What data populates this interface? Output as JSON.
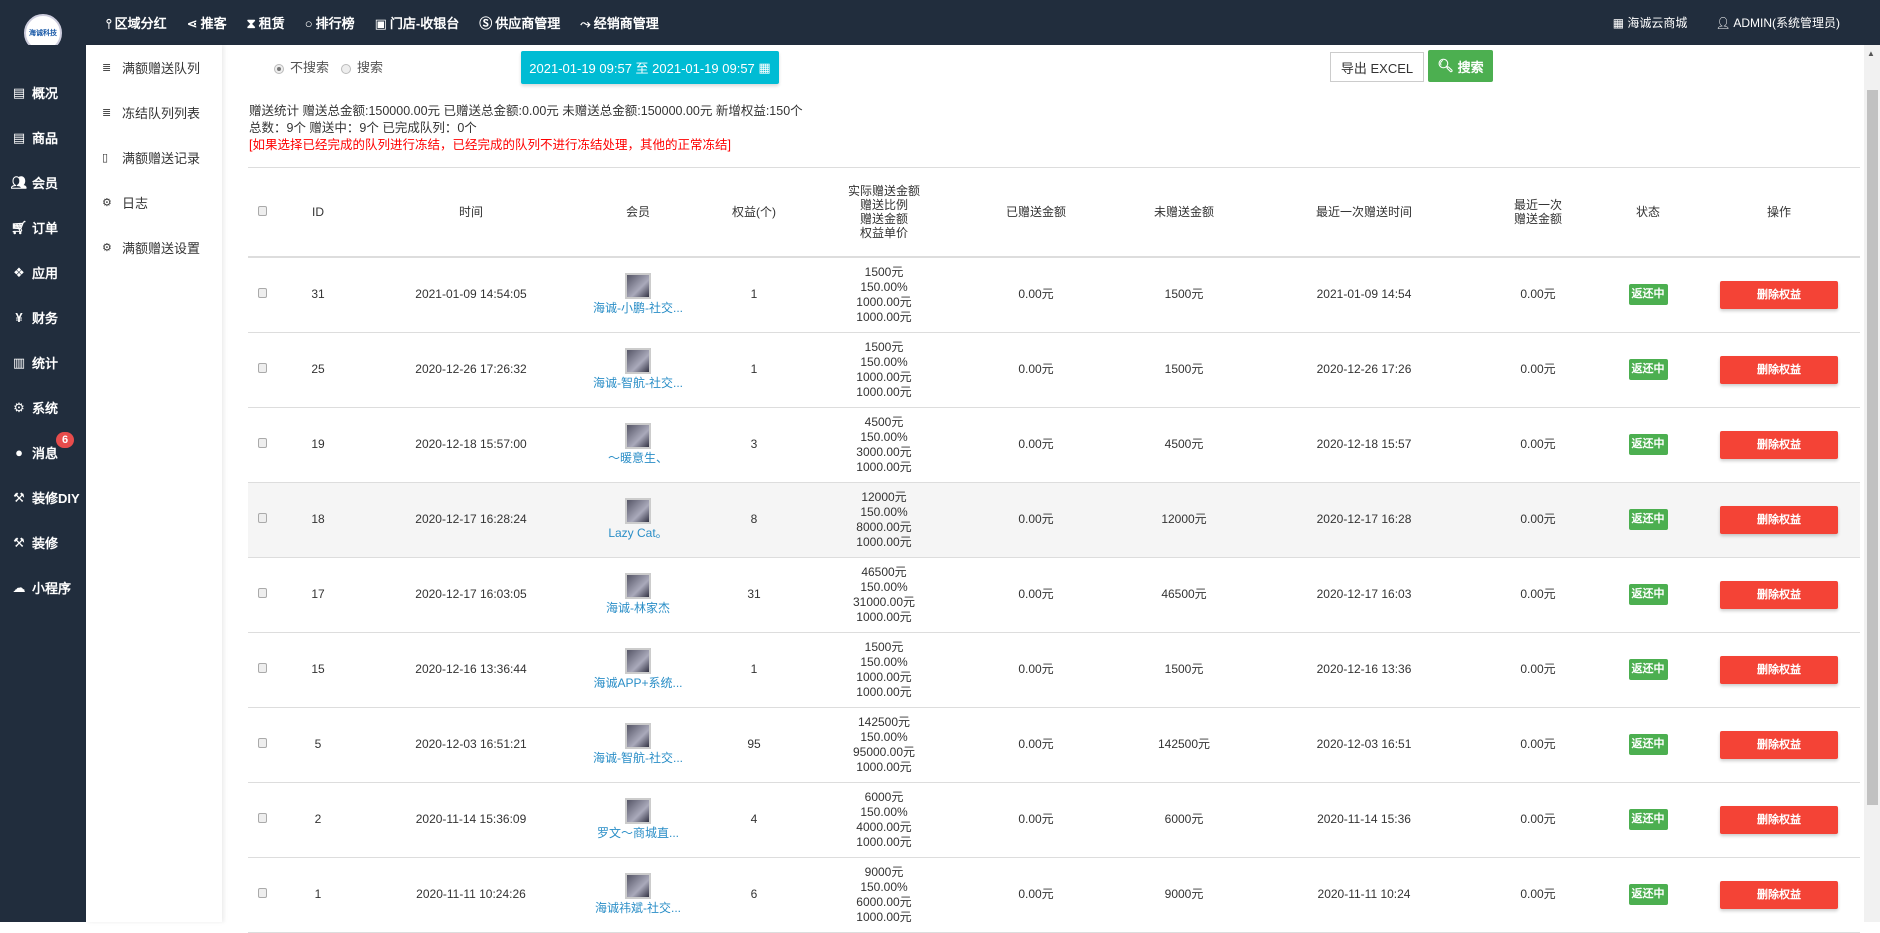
{
  "topnav": {
    "items": [
      {
        "icon": "tie-icon",
        "label": "区域分红"
      },
      {
        "icon": "share-icon",
        "label": "推客"
      },
      {
        "icon": "hourglass-icon",
        "label": "租赁"
      },
      {
        "icon": "circle-icon",
        "label": "排行榜"
      },
      {
        "icon": "cash-icon",
        "label": "门店-收银台"
      },
      {
        "icon": "skype-icon",
        "label": "供应商管理"
      },
      {
        "icon": "handshake-icon",
        "label": "经销商管理"
      }
    ],
    "shop": "海诚云商城",
    "user": "ADMIN(系统管理员)"
  },
  "logo": "海诚科技",
  "sidebar": {
    "items": [
      {
        "icon": "window-icon",
        "label": "概况"
      },
      {
        "icon": "window-icon",
        "label": "商品"
      },
      {
        "icon": "users-icon",
        "label": "会员"
      },
      {
        "icon": "cart-icon",
        "label": "订单"
      },
      {
        "icon": "cubes-icon",
        "label": "应用"
      },
      {
        "icon": "yen-icon",
        "label": "财务"
      },
      {
        "icon": "bar-chart-icon",
        "label": "统计"
      },
      {
        "icon": "gears-icon",
        "label": "系统"
      },
      {
        "icon": "comment-icon",
        "label": "消息",
        "badge": "6"
      },
      {
        "icon": "gavel-icon",
        "label": "装修DIY"
      },
      {
        "icon": "gavel-icon",
        "label": "装修"
      },
      {
        "icon": "wechat-icon",
        "label": "小程序"
      }
    ]
  },
  "subnav": {
    "items": [
      {
        "icon": "database-icon",
        "label": "满额赠送队列"
      },
      {
        "icon": "database-icon",
        "label": "冻结队列列表"
      },
      {
        "icon": "calendar-icon",
        "label": "满额赠送记录"
      },
      {
        "icon": "gears-icon",
        "label": "日志"
      },
      {
        "icon": "gears-icon",
        "label": "满额赠送设置"
      }
    ]
  },
  "filter": {
    "radio_no": "不搜索",
    "radio_yes": "搜索",
    "date_range": "2021-01-19 09:57 至 2021-01-19 09:57",
    "export": "导出 EXCEL",
    "search": "搜索"
  },
  "stats": {
    "line1": "赠送统计 赠送总金额:150000.00元 已赠送总金额:0.00元 未赠送总金额:150000.00元 新增权益:150个",
    "line2": "总数：9个 赠送中：9个 已完成队列：0个",
    "warning": "[如果选择已经完成的队列进行冻结，已经完成的队列不进行冻结处理，其他的正常冻结]"
  },
  "table": {
    "headers": {
      "id": "ID",
      "time": "时间",
      "member": "会员",
      "rights": "权益(个)",
      "amount1": "实际赠送金额",
      "amount2": "赠送比例",
      "amount3": "赠送金额",
      "amount4": "权益单价",
      "given": "已赠送金额",
      "ungiven": "未赠送金额",
      "last_time": "最近一次赠送时间",
      "last_amount1": "最近一次",
      "last_amount2": "赠送金额",
      "status": "状态",
      "action": "操作"
    },
    "rows": [
      {
        "id": "31",
        "time": "2021-01-09 14:54:05",
        "member": "海诚-小鹏-社交...",
        "rights": "1",
        "actual": "1500元",
        "ratio": "150.00%",
        "amount": "1000.00元",
        "price": "1000.00元",
        "given": "0.00元",
        "ungiven": "1500元",
        "last_time": "2021-01-09 14:54",
        "last_amount": "0.00元",
        "status": "返还中",
        "action": "删除权益"
      },
      {
        "id": "25",
        "time": "2020-12-26 17:26:32",
        "member": "海诚-智航-社交...",
        "rights": "1",
        "actual": "1500元",
        "ratio": "150.00%",
        "amount": "1000.00元",
        "price": "1000.00元",
        "given": "0.00元",
        "ungiven": "1500元",
        "last_time": "2020-12-26 17:26",
        "last_amount": "0.00元",
        "status": "返还中",
        "action": "删除权益"
      },
      {
        "id": "19",
        "time": "2020-12-18 15:57:00",
        "member": "～暖意生、",
        "rights": "3",
        "actual": "4500元",
        "ratio": "150.00%",
        "amount": "3000.00元",
        "price": "1000.00元",
        "given": "0.00元",
        "ungiven": "4500元",
        "last_time": "2020-12-18 15:57",
        "last_amount": "0.00元",
        "status": "返还中",
        "action": "删除权益"
      },
      {
        "id": "18",
        "time": "2020-12-17 16:28:24",
        "member": "Lazy Cat。",
        "rights": "8",
        "actual": "12000元",
        "ratio": "150.00%",
        "amount": "8000.00元",
        "price": "1000.00元",
        "given": "0.00元",
        "ungiven": "12000元",
        "last_time": "2020-12-17 16:28",
        "last_amount": "0.00元",
        "status": "返还中",
        "action": "删除权益"
      },
      {
        "id": "17",
        "time": "2020-12-17 16:03:05",
        "member": "海诚-林家杰",
        "rights": "31",
        "actual": "46500元",
        "ratio": "150.00%",
        "amount": "31000.00元",
        "price": "1000.00元",
        "given": "0.00元",
        "ungiven": "46500元",
        "last_time": "2020-12-17 16:03",
        "last_amount": "0.00元",
        "status": "返还中",
        "action": "删除权益"
      },
      {
        "id": "15",
        "time": "2020-12-16 13:36:44",
        "member": "海诚APP+系统...",
        "rights": "1",
        "actual": "1500元",
        "ratio": "150.00%",
        "amount": "1000.00元",
        "price": "1000.00元",
        "given": "0.00元",
        "ungiven": "1500元",
        "last_time": "2020-12-16 13:36",
        "last_amount": "0.00元",
        "status": "返还中",
        "action": "删除权益"
      },
      {
        "id": "5",
        "time": "2020-12-03 16:51:21",
        "member": "海诚-智航-社交...",
        "rights": "95",
        "actual": "142500元",
        "ratio": "150.00%",
        "amount": "95000.00元",
        "price": "1000.00元",
        "given": "0.00元",
        "ungiven": "142500元",
        "last_time": "2020-12-03 16:51",
        "last_amount": "0.00元",
        "status": "返还中",
        "action": "删除权益"
      },
      {
        "id": "2",
        "time": "2020-11-14 15:36:09",
        "member": "罗文～商城直...",
        "rights": "4",
        "actual": "6000元",
        "ratio": "150.00%",
        "amount": "4000.00元",
        "price": "1000.00元",
        "given": "0.00元",
        "ungiven": "6000元",
        "last_time": "2020-11-14 15:36",
        "last_amount": "0.00元",
        "status": "返还中",
        "action": "删除权益"
      },
      {
        "id": "1",
        "time": "2020-11-11 10:24:26",
        "member": "海诚祎斌-社交...",
        "rights": "6",
        "actual": "9000元",
        "ratio": "150.00%",
        "amount": "6000.00元",
        "price": "1000.00元",
        "given": "0.00元",
        "ungiven": "9000元",
        "last_time": "2020-11-11 10:24",
        "last_amount": "0.00元",
        "status": "返还中",
        "action": "删除权益"
      }
    ]
  }
}
